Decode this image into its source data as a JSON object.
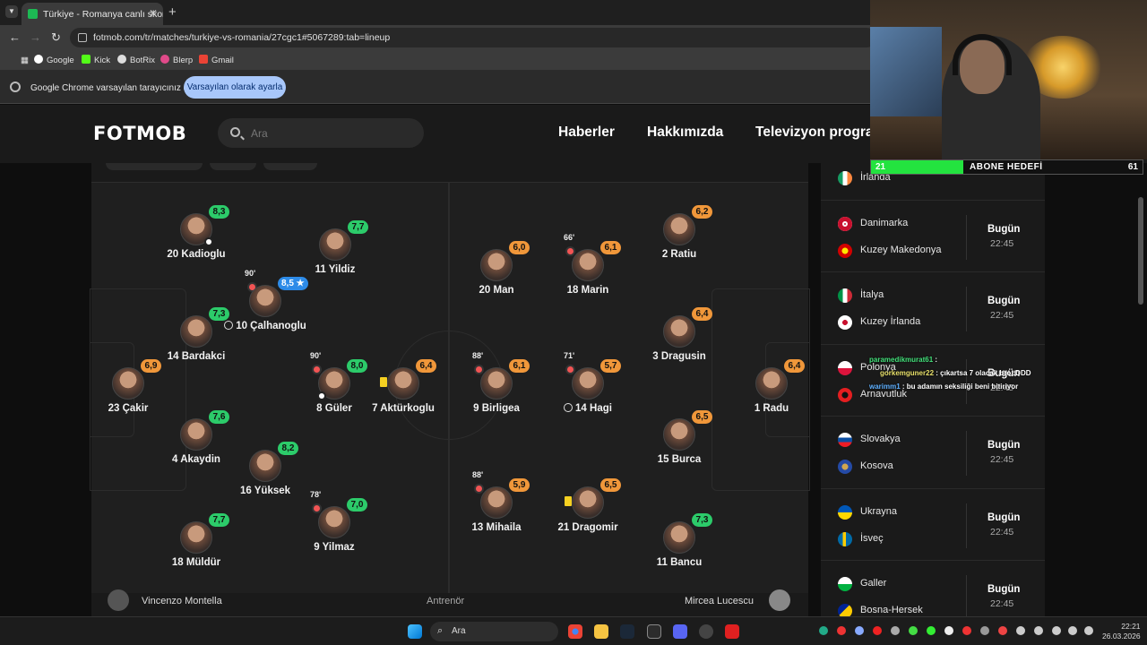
{
  "browser": {
    "tab_title": "Türkiye - Romanya canlı skor, ta",
    "url": "fotmob.com/tr/matches/turkiye-vs-romania/27cgc1#5067289:tab=lineup",
    "bookmarks": [
      "Google",
      "Kick",
      "BotRix",
      "Blerp",
      "Gmail"
    ],
    "info_message": "Google Chrome varsayılan tarayıcınız değil",
    "info_button": "Varsayılan olarak ayarla"
  },
  "header": {
    "logo": "FOTMOB",
    "search_placeholder": "Ara",
    "nav": [
      "Haberler",
      "Hakkımızda",
      "Televizyon progra"
    ]
  },
  "lineup": {
    "home": [
      {
        "name": "20 Kadioglu",
        "rating": "8,3",
        "color": "green"
      },
      {
        "name": "11 Yildiz",
        "rating": "7,7",
        "color": "green"
      },
      {
        "name": "10 Çalhanoglu",
        "rating": "8,5 ★",
        "color": "blue",
        "sub": "90'"
      },
      {
        "name": "14 Bardakci",
        "rating": "7,3",
        "color": "green"
      },
      {
        "name": "23 Çakir",
        "rating": "6,9",
        "color": "orange"
      },
      {
        "name": "8 Güler",
        "rating": "8,0",
        "color": "green",
        "sub": "90'"
      },
      {
        "name": "7 Aktürkoglu",
        "rating": "6,4",
        "color": "orange"
      },
      {
        "name": "4 Akaydin",
        "rating": "7,6",
        "color": "green"
      },
      {
        "name": "16 Yüksek",
        "rating": "8,2",
        "color": "green"
      },
      {
        "name": "9 Yilmaz",
        "rating": "7,0",
        "color": "green",
        "sub": "78'"
      },
      {
        "name": "18 Müldür",
        "rating": "7,7",
        "color": "green"
      }
    ],
    "away": [
      {
        "name": "20 Man",
        "rating": "6,0",
        "color": "orange"
      },
      {
        "name": "18 Marin",
        "rating": "6,1",
        "color": "orange",
        "sub": "66'"
      },
      {
        "name": "2 Ratiu",
        "rating": "6,2",
        "color": "orange"
      },
      {
        "name": "3 Dragusin",
        "rating": "6,4",
        "color": "orange"
      },
      {
        "name": "9 Birligea",
        "rating": "6,1",
        "color": "orange",
        "sub": "88'"
      },
      {
        "name": "14 Hagi",
        "rating": "5,7",
        "color": "orange",
        "sub": "71'"
      },
      {
        "name": "1 Radu",
        "rating": "6,4",
        "color": "orange"
      },
      {
        "name": "15 Burca",
        "rating": "6,5",
        "color": "orange"
      },
      {
        "name": "13 Mihaila",
        "rating": "5,9",
        "color": "orange",
        "sub": "88'"
      },
      {
        "name": "21 Dragomir",
        "rating": "6,5",
        "color": "orange"
      },
      {
        "name": "11 Bancu",
        "rating": "7,3",
        "color": "green"
      }
    ],
    "coach_home": "Vincenzo Montella",
    "coach_away": "Mircea Lucescu",
    "coach_label": "Antrenör"
  },
  "matches": [
    {
      "home": "İrlanda",
      "away": "",
      "day": "",
      "time": ""
    },
    {
      "home": "Danimarka",
      "away": "Kuzey Makedonya",
      "day": "Bugün",
      "time": "22:45"
    },
    {
      "home": "İtalya",
      "away": "Kuzey İrlanda",
      "day": "Bugün",
      "time": "22:45"
    },
    {
      "home": "Polonya",
      "away": "Arnavutluk",
      "day": "Bugün",
      "time": "22:45"
    },
    {
      "home": "Slovakya",
      "away": "Kosova",
      "day": "Bugün",
      "time": "22:45"
    },
    {
      "home": "Ukrayna",
      "away": "İsveç",
      "day": "Bugün",
      "time": "22:45"
    },
    {
      "home": "Galler",
      "away": "Bosna-Hersek",
      "day": "Bugün",
      "time": "22:45"
    }
  ],
  "overlay": {
    "goal_current": "21",
    "goal_label": "ABONE HEDEFİ",
    "goal_target": "61",
    "goal_fraction": 0.34,
    "chat": [
      {
        "user": "paramedikmurat61",
        "text": ""
      },
      {
        "user": "gorkemguner22",
        "text": "çıkartsa 7 olacak bro :DDD"
      },
      {
        "user": "warimm1",
        "text": "bu adamın seksiliği beni bitiriyor"
      }
    ]
  },
  "taskbar": {
    "search": "Ara",
    "time": "22:21",
    "date": "26.03.2026"
  }
}
